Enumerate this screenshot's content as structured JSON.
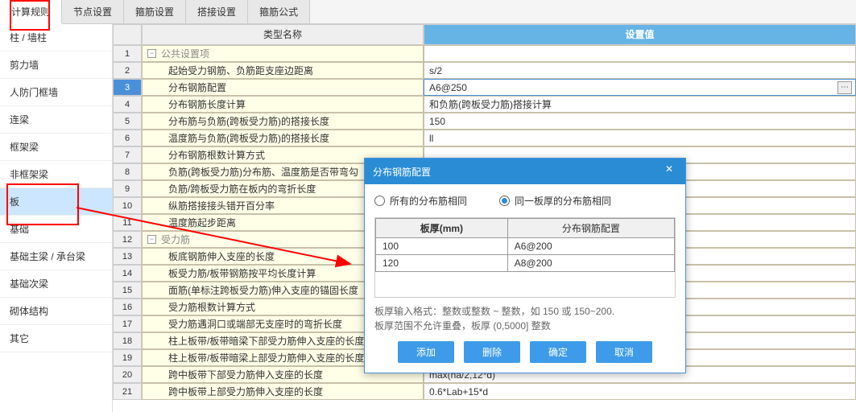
{
  "tabs": [
    "计算规则",
    "节点设置",
    "箍筋设置",
    "搭接设置",
    "箍筋公式"
  ],
  "activeTab": 0,
  "sidebar": [
    "柱 / 墙柱",
    "剪力墙",
    "人防门框墙",
    "连梁",
    "框架梁",
    "非框架梁",
    "板",
    "基础",
    "基础主梁 / 承台梁",
    "基础次梁",
    "砌体结构",
    "其它"
  ],
  "selectedSidebar": 6,
  "header": {
    "name": "类型名称",
    "value": "设置值"
  },
  "rows": [
    {
      "n": 1,
      "group": true,
      "name": "公共设置项",
      "val": ""
    },
    {
      "n": 2,
      "name": "起始受力钢筋、负筋距支座边距离",
      "val": "s/2"
    },
    {
      "n": 3,
      "name": "分布钢筋配置",
      "val": "A6@250",
      "sel": true,
      "ell": true
    },
    {
      "n": 4,
      "name": "分布钢筋长度计算",
      "val": "和负筋(跨板受力筋)搭接计算"
    },
    {
      "n": 5,
      "name": "分布筋与负筋(跨板受力筋)的搭接长度",
      "val": "150"
    },
    {
      "n": 6,
      "name": "温度筋与负筋(跨板受力筋)的搭接长度",
      "val": "ll"
    },
    {
      "n": 7,
      "name": "分布钢筋根数计算方式",
      "val": ""
    },
    {
      "n": 8,
      "name": "负筋(跨板受力筋)分布筋、温度筋是否带弯勾",
      "val": ""
    },
    {
      "n": 9,
      "name": "负筋/跨板受力筋在板内的弯折长度",
      "val": ""
    },
    {
      "n": 10,
      "name": "纵筋搭接接头错开百分率",
      "val": ""
    },
    {
      "n": 11,
      "name": "温度筋起步距离",
      "val": ""
    },
    {
      "n": 12,
      "group": true,
      "name": "受力筋",
      "val": ""
    },
    {
      "n": 13,
      "name": "板底钢筋伸入支座的长度",
      "val": ""
    },
    {
      "n": 14,
      "name": "板受力筋/板带钢筋按平均长度计算",
      "val": ""
    },
    {
      "n": 15,
      "name": "面筋(单标注跨板受力筋)伸入支座的锚固长度",
      "val": ""
    },
    {
      "n": 16,
      "name": "受力筋根数计算方式",
      "val": ""
    },
    {
      "n": 17,
      "name": "受力筋遇洞口或端部无支座时的弯折长度",
      "val": ""
    },
    {
      "n": 18,
      "name": "柱上板带/板带暗梁下部受力筋伸入支座的长度",
      "val": ""
    },
    {
      "n": 19,
      "name": "柱上板带/板带暗梁上部受力筋伸入支座的长度",
      "val": ""
    },
    {
      "n": 20,
      "name": "跨中板带下部受力筋伸入支座的长度",
      "val": "max(ha/2,12*d)"
    },
    {
      "n": 21,
      "name": "跨中板带上部受力筋伸入支座的长度",
      "val": "0.6*Lab+15*d"
    }
  ],
  "dialog": {
    "title": "分布钢筋配置",
    "radio1": "所有的分布筋相同",
    "radio2": "同一板厚的分布筋相同",
    "th1": "板厚(mm)",
    "th2": "分布钢筋配置",
    "table": [
      {
        "t": "100",
        "c": "A6@200"
      },
      {
        "t": "120",
        "c": "A8@200"
      }
    ],
    "hint1": "板厚输入格式：整数或整数 ~ 整数，如 150 或 150~200.",
    "hint2": "板厚范围不允许重叠，板厚 (0,5000] 整数",
    "btns": [
      "添加",
      "删除",
      "确定",
      "取消"
    ]
  }
}
